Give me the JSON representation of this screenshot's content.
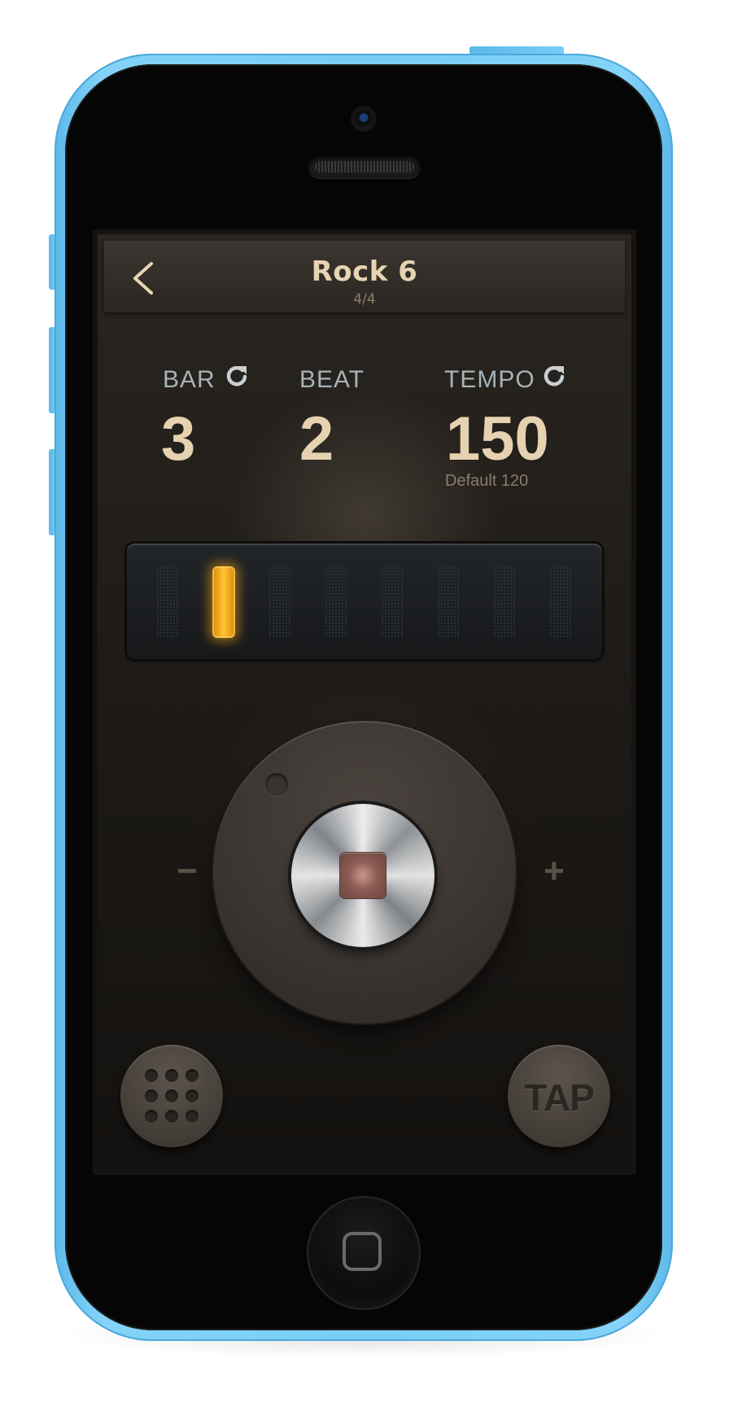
{
  "header": {
    "title": "Rock 6",
    "subtitle": "4/4"
  },
  "stats": {
    "bar": {
      "label": "BAR",
      "value": "3"
    },
    "beat": {
      "label": "BEAT",
      "value": "2"
    },
    "tempo": {
      "label": "TEMPO",
      "value": "150",
      "default_text": "Default 120"
    }
  },
  "beat_indicator": {
    "slots": 8,
    "active_index": 1,
    "active_color": "#ffc433"
  },
  "controls": {
    "decrease_label": "−",
    "increase_label": "+",
    "tap_label": "TAP"
  },
  "icons": {
    "back": "chevron-left-icon",
    "reset": "refresh-icon",
    "stop": "stop-icon",
    "grid": "grid-dots-icon",
    "home": "home-square-icon"
  },
  "colors": {
    "device_shell": "#79cdf5",
    "title_text": "#e7d4b2",
    "label_text": "#a8b2b8"
  }
}
